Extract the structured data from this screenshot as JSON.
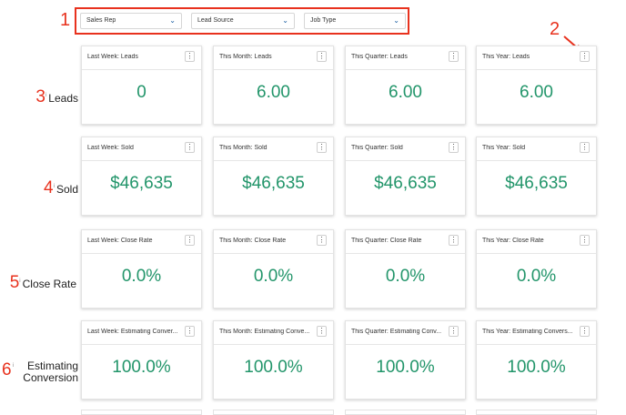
{
  "annotations": {
    "n1": "1",
    "n2": "2"
  },
  "filters": [
    {
      "label": "Sales Rep"
    },
    {
      "label": "Lead Source"
    },
    {
      "label": "Job Type"
    }
  ],
  "rows": [
    {
      "num": "3",
      "label": "Leads",
      "cards": [
        {
          "title": "Last Week: Leads",
          "value": "0"
        },
        {
          "title": "This Month: Leads",
          "value": "6.00"
        },
        {
          "title": "This Quarter: Leads",
          "value": "6.00"
        },
        {
          "title": "This Year: Leads",
          "value": "6.00"
        }
      ]
    },
    {
      "num": "4",
      "label": "Sold",
      "cards": [
        {
          "title": "Last Week: Sold",
          "value": "$46,635"
        },
        {
          "title": "This Month: Sold",
          "value": "$46,635"
        },
        {
          "title": "This Quarter: Sold",
          "value": "$46,635"
        },
        {
          "title": "This Year: Sold",
          "value": "$46,635"
        }
      ]
    },
    {
      "num": "5",
      "label": "Close Rate",
      "cards": [
        {
          "title": "Last Week: Close Rate",
          "value": "0.0%"
        },
        {
          "title": "This Month: Close Rate",
          "value": "0.0%"
        },
        {
          "title": "This Quarter: Close Rate",
          "value": "0.0%"
        },
        {
          "title": "This Year: Close Rate",
          "value": "0.0%"
        }
      ]
    },
    {
      "num": "6",
      "label": "Estimating",
      "label2": "Conversion",
      "cards": [
        {
          "title": "Last Week: Estimating Conver...",
          "value": "100.0%"
        },
        {
          "title": "This Month: Estimating Conve...",
          "value": "100.0%"
        },
        {
          "title": "This Quarter: Estimating Conv...",
          "value": "100.0%"
        },
        {
          "title": "This Year: Estimating Convers...",
          "value": "100.0%"
        }
      ]
    }
  ],
  "icons": {
    "info": "i",
    "menu": "⋮",
    "chevron": "⌄"
  },
  "colors": {
    "annotation": "#e8321e",
    "value": "#22956a",
    "chevron": "#1b5fa3"
  }
}
